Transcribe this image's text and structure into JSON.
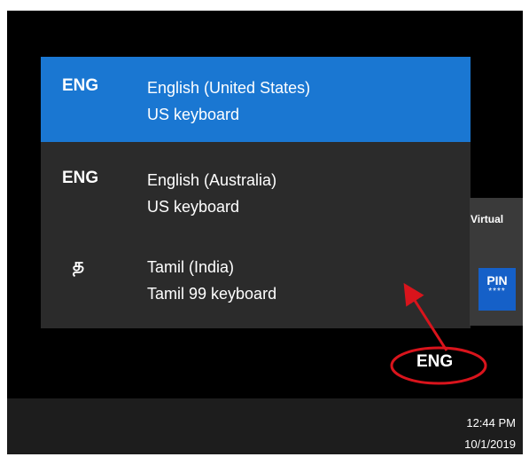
{
  "languages": [
    {
      "code": "ENG",
      "name": "English (United States)",
      "layout": "US keyboard",
      "selected": true
    },
    {
      "code": "ENG",
      "name": "English (Australia)",
      "layout": "US keyboard",
      "selected": false
    },
    {
      "code": "த",
      "name": "Tamil (India)",
      "layout": "Tamil 99 keyboard",
      "selected": false
    }
  ],
  "side_panel": {
    "virtual_label": "Virtual",
    "pin_text": "PIN",
    "pin_stars": "****"
  },
  "tray": {
    "language_indicator": "ENG",
    "time": "12:44 PM",
    "date": "10/1/2019"
  },
  "colors": {
    "selected": "#1a77d2",
    "flyout": "#2b2b2b",
    "annotation": "#d9141c"
  }
}
